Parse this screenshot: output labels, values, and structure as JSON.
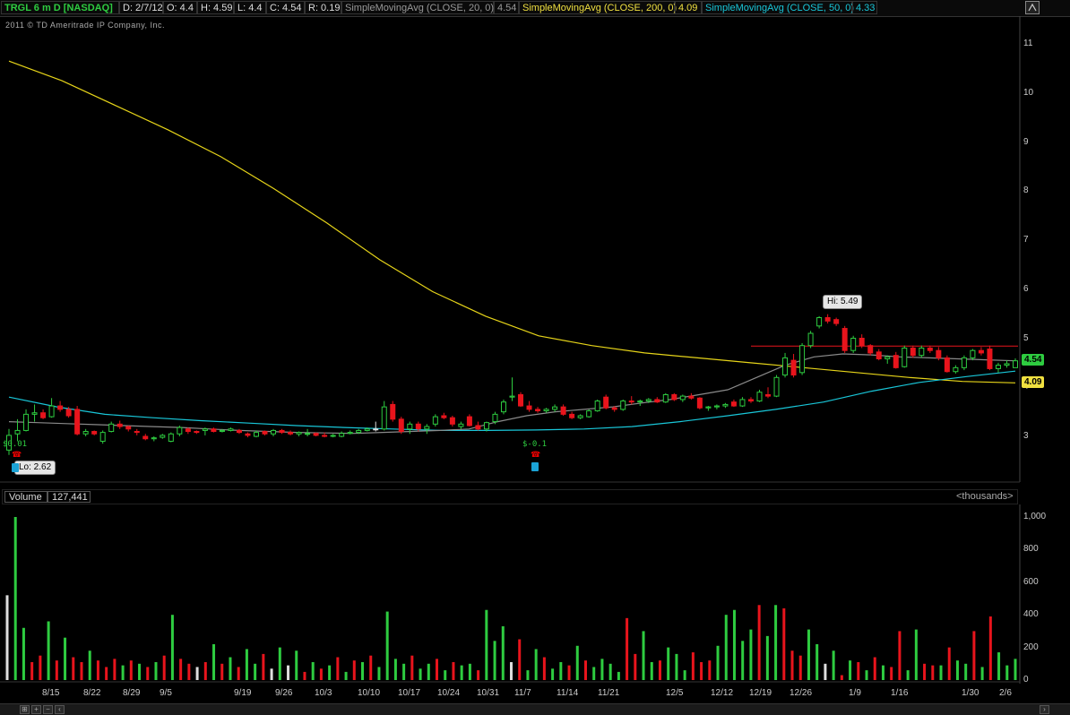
{
  "header": {
    "symbol": "TRGL 6 m D [NASDAQ]",
    "date": "D: 2/7/12",
    "open": "O: 4.4",
    "high": "H: 4.59",
    "low": "L: 4.4",
    "close": "C: 4.54",
    "range": "R: 0.19",
    "sma20_label": "SimpleMovingAvg (CLOSE, 20, 0)",
    "sma20_value": "4.54",
    "sma200_label": "SimpleMovingAvg (CLOSE, 200, 0)",
    "sma200_value": "4.09",
    "sma50_label": "SimpleMovingAvg (CLOSE, 50, 0)",
    "sma50_value": "4.33"
  },
  "copyright": "2011 © TD Ameritrade IP Company, Inc.",
  "annotations": {
    "hi": "Hi: 5.49",
    "lo": "Lo: 2.62",
    "dividend1": "$0.01",
    "dividend2": "$-0.1",
    "price_tag_green": "4.54",
    "price_tag_yellow": "4.09"
  },
  "volume_panel": {
    "label": "Volume",
    "value": "127,441",
    "units": "<thousands>"
  },
  "colors": {
    "up": "#2ecc40",
    "down": "#e8141c",
    "neutral": "#dddddd",
    "sma20": "#8a8a8a",
    "sma200": "#e6d419",
    "sma50": "#19c6d8",
    "resistance": "#e8141c"
  },
  "chart_data": [
    {
      "type": "candlestick",
      "title": "TRGL 6 m D [NASDAQ]",
      "ylim": [
        2.5,
        11.3
      ],
      "y_ticks": [
        3,
        4,
        5,
        6,
        7,
        8,
        9,
        10,
        11
      ],
      "x_ticks": [
        "8/15",
        "8/22",
        "8/29",
        "9/5",
        "9/19",
        "9/26",
        "10/3",
        "10/10",
        "10/17",
        "10/24",
        "10/31",
        "11/7",
        "11/14",
        "11/21",
        "12/5",
        "12/12",
        "12/19",
        "12/26",
        "1/9",
        "1/16",
        "1/30",
        "2/6"
      ],
      "candles": [
        {
          "o": 2.72,
          "h": 3.15,
          "l": 2.62,
          "c": 3.02
        },
        {
          "o": 3.05,
          "h": 3.35,
          "l": 2.9,
          "c": 3.12
        },
        {
          "o": 3.12,
          "h": 3.55,
          "l": 3.1,
          "c": 3.45
        },
        {
          "o": 3.45,
          "h": 3.65,
          "l": 3.3,
          "c": 3.48
        },
        {
          "o": 3.48,
          "h": 3.55,
          "l": 3.35,
          "c": 3.38
        },
        {
          "o": 3.4,
          "h": 3.78,
          "l": 3.38,
          "c": 3.62
        },
        {
          "o": 3.62,
          "h": 3.72,
          "l": 3.5,
          "c": 3.55
        },
        {
          "o": 3.55,
          "h": 3.6,
          "l": 3.38,
          "c": 3.42
        },
        {
          "o": 3.55,
          "h": 3.62,
          "l": 3.02,
          "c": 3.05
        },
        {
          "o": 3.05,
          "h": 3.15,
          "l": 3.0,
          "c": 3.1
        },
        {
          "o": 3.1,
          "h": 3.12,
          "l": 3.02,
          "c": 3.05
        },
        {
          "o": 2.9,
          "h": 3.12,
          "l": 2.85,
          "c": 3.08
        },
        {
          "o": 3.1,
          "h": 3.3,
          "l": 3.08,
          "c": 3.25
        },
        {
          "o": 3.25,
          "h": 3.32,
          "l": 3.15,
          "c": 3.2
        },
        {
          "o": 3.2,
          "h": 3.22,
          "l": 3.1,
          "c": 3.15
        },
        {
          "o": 3.1,
          "h": 3.15,
          "l": 3.02,
          "c": 3.08
        },
        {
          "o": 3.0,
          "h": 3.05,
          "l": 2.92,
          "c": 2.95
        },
        {
          "o": 2.95,
          "h": 3.0,
          "l": 2.9,
          "c": 2.97
        },
        {
          "o": 2.98,
          "h": 3.05,
          "l": 2.95,
          "c": 3.02
        },
        {
          "o": 2.9,
          "h": 3.08,
          "l": 2.88,
          "c": 3.05
        },
        {
          "o": 3.05,
          "h": 3.22,
          "l": 3.0,
          "c": 3.18
        },
        {
          "o": 3.15,
          "h": 3.18,
          "l": 3.05,
          "c": 3.1
        },
        {
          "o": 3.1,
          "h": 3.12,
          "l": 3.05,
          "c": 3.08
        },
        {
          "o": 3.12,
          "h": 3.18,
          "l": 3.02,
          "c": 3.15
        },
        {
          "o": 3.15,
          "h": 3.18,
          "l": 3.08,
          "c": 3.1
        },
        {
          "o": 3.1,
          "h": 3.15,
          "l": 3.08,
          "c": 3.12
        },
        {
          "o": 3.12,
          "h": 3.18,
          "l": 3.1,
          "c": 3.15
        },
        {
          "o": 3.12,
          "h": 3.15,
          "l": 3.05,
          "c": 3.08
        },
        {
          "o": 3.05,
          "h": 3.08,
          "l": 2.98,
          "c": 3.02
        },
        {
          "o": 3.0,
          "h": 3.12,
          "l": 2.98,
          "c": 3.08
        },
        {
          "o": 3.1,
          "h": 3.12,
          "l": 3.02,
          "c": 3.05
        },
        {
          "o": 3.05,
          "h": 3.15,
          "l": 3.0,
          "c": 3.12
        },
        {
          "o": 3.12,
          "h": 3.15,
          "l": 3.05,
          "c": 3.08
        },
        {
          "o": 3.08,
          "h": 3.12,
          "l": 3.02,
          "c": 3.05
        },
        {
          "o": 3.05,
          "h": 3.1,
          "l": 3.0,
          "c": 3.08
        },
        {
          "o": 3.05,
          "h": 3.15,
          "l": 3.0,
          "c": 3.06
        },
        {
          "o": 3.06,
          "h": 3.08,
          "l": 3.0,
          "c": 3.02
        },
        {
          "o": 3.02,
          "h": 3.08,
          "l": 2.98,
          "c": 3.0
        },
        {
          "o": 3.0,
          "h": 3.05,
          "l": 2.98,
          "c": 3.02
        },
        {
          "o": 3.0,
          "h": 3.1,
          "l": 2.98,
          "c": 3.06
        },
        {
          "o": 3.06,
          "h": 3.12,
          "l": 3.04,
          "c": 3.08
        },
        {
          "o": 3.08,
          "h": 3.15,
          "l": 3.05,
          "c": 3.12
        },
        {
          "o": 3.12,
          "h": 3.18,
          "l": 3.1,
          "c": 3.15
        },
        {
          "o": 3.15,
          "h": 3.3,
          "l": 3.1,
          "c": 3.15
        },
        {
          "o": 3.15,
          "h": 3.72,
          "l": 3.12,
          "c": 3.6
        },
        {
          "o": 3.65,
          "h": 3.72,
          "l": 3.3,
          "c": 3.35
        },
        {
          "o": 3.35,
          "h": 3.4,
          "l": 3.05,
          "c": 3.1
        },
        {
          "o": 3.15,
          "h": 3.3,
          "l": 3.05,
          "c": 3.25
        },
        {
          "o": 3.25,
          "h": 3.3,
          "l": 3.1,
          "c": 3.15
        },
        {
          "o": 3.15,
          "h": 3.25,
          "l": 3.05,
          "c": 3.2
        },
        {
          "o": 3.25,
          "h": 3.45,
          "l": 3.2,
          "c": 3.4
        },
        {
          "o": 3.42,
          "h": 3.48,
          "l": 3.35,
          "c": 3.38
        },
        {
          "o": 3.38,
          "h": 3.42,
          "l": 3.2,
          "c": 3.25
        },
        {
          "o": 3.2,
          "h": 3.3,
          "l": 3.15,
          "c": 3.25
        },
        {
          "o": 3.4,
          "h": 3.45,
          "l": 3.2,
          "c": 3.22
        },
        {
          "o": 3.22,
          "h": 3.3,
          "l": 3.12,
          "c": 3.15
        },
        {
          "o": 3.15,
          "h": 3.3,
          "l": 3.1,
          "c": 3.28
        },
        {
          "o": 3.3,
          "h": 3.5,
          "l": 3.25,
          "c": 3.45
        },
        {
          "o": 3.5,
          "h": 3.75,
          "l": 3.45,
          "c": 3.7
        },
        {
          "o": 3.8,
          "h": 4.2,
          "l": 3.72,
          "c": 3.82
        },
        {
          "o": 3.85,
          "h": 3.9,
          "l": 3.6,
          "c": 3.62
        },
        {
          "o": 3.62,
          "h": 3.72,
          "l": 3.5,
          "c": 3.55
        },
        {
          "o": 3.55,
          "h": 3.6,
          "l": 3.48,
          "c": 3.52
        },
        {
          "o": 3.52,
          "h": 3.58,
          "l": 3.48,
          "c": 3.55
        },
        {
          "o": 3.55,
          "h": 3.65,
          "l": 3.5,
          "c": 3.6
        },
        {
          "o": 3.6,
          "h": 3.65,
          "l": 3.42,
          "c": 3.45
        },
        {
          "o": 3.45,
          "h": 3.5,
          "l": 3.35,
          "c": 3.38
        },
        {
          "o": 3.38,
          "h": 3.45,
          "l": 3.35,
          "c": 3.42
        },
        {
          "o": 3.4,
          "h": 3.55,
          "l": 3.38,
          "c": 3.52
        },
        {
          "o": 3.52,
          "h": 3.75,
          "l": 3.5,
          "c": 3.72
        },
        {
          "o": 3.8,
          "h": 3.85,
          "l": 3.55,
          "c": 3.58
        },
        {
          "o": 3.58,
          "h": 3.62,
          "l": 3.5,
          "c": 3.55
        },
        {
          "o": 3.55,
          "h": 3.75,
          "l": 3.52,
          "c": 3.72
        },
        {
          "o": 3.72,
          "h": 3.82,
          "l": 3.65,
          "c": 3.7
        },
        {
          "o": 3.7,
          "h": 3.75,
          "l": 3.62,
          "c": 3.72
        },
        {
          "o": 3.72,
          "h": 3.78,
          "l": 3.68,
          "c": 3.75
        },
        {
          "o": 3.75,
          "h": 3.8,
          "l": 3.68,
          "c": 3.7
        },
        {
          "o": 3.7,
          "h": 3.88,
          "l": 3.68,
          "c": 3.85
        },
        {
          "o": 3.85,
          "h": 3.88,
          "l": 3.72,
          "c": 3.75
        },
        {
          "o": 3.75,
          "h": 3.85,
          "l": 3.7,
          "c": 3.82
        },
        {
          "o": 3.82,
          "h": 3.88,
          "l": 3.75,
          "c": 3.78
        },
        {
          "o": 3.78,
          "h": 3.8,
          "l": 3.55,
          "c": 3.58
        },
        {
          "o": 3.58,
          "h": 3.62,
          "l": 3.52,
          "c": 3.6
        },
        {
          "o": 3.6,
          "h": 3.65,
          "l": 3.55,
          "c": 3.62
        },
        {
          "o": 3.62,
          "h": 3.68,
          "l": 3.58,
          "c": 3.65
        },
        {
          "o": 3.7,
          "h": 3.75,
          "l": 3.6,
          "c": 3.62
        },
        {
          "o": 3.62,
          "h": 3.8,
          "l": 3.6,
          "c": 3.75
        },
        {
          "o": 3.75,
          "h": 3.8,
          "l": 3.68,
          "c": 3.72
        },
        {
          "o": 3.72,
          "h": 3.95,
          "l": 3.7,
          "c": 3.9
        },
        {
          "o": 3.85,
          "h": 4.0,
          "l": 3.78,
          "c": 3.82
        },
        {
          "o": 3.82,
          "h": 4.25,
          "l": 3.8,
          "c": 4.2
        },
        {
          "o": 4.25,
          "h": 4.7,
          "l": 4.2,
          "c": 4.6
        },
        {
          "o": 4.55,
          "h": 4.68,
          "l": 4.2,
          "c": 4.25
        },
        {
          "o": 4.3,
          "h": 4.9,
          "l": 4.25,
          "c": 4.85
        },
        {
          "o": 4.85,
          "h": 5.15,
          "l": 4.8,
          "c": 5.1
        },
        {
          "o": 5.25,
          "h": 5.45,
          "l": 5.2,
          "c": 5.42
        },
        {
          "o": 5.42,
          "h": 5.49,
          "l": 5.3,
          "c": 5.35
        },
        {
          "o": 5.38,
          "h": 5.42,
          "l": 5.25,
          "c": 5.3
        },
        {
          "o": 5.2,
          "h": 5.25,
          "l": 4.7,
          "c": 4.75
        },
        {
          "o": 4.75,
          "h": 5.05,
          "l": 4.7,
          "c": 5.0
        },
        {
          "o": 5.0,
          "h": 5.08,
          "l": 4.8,
          "c": 4.85
        },
        {
          "o": 4.85,
          "h": 4.88,
          "l": 4.65,
          "c": 4.7
        },
        {
          "o": 4.72,
          "h": 4.78,
          "l": 4.55,
          "c": 4.58
        },
        {
          "o": 4.58,
          "h": 4.65,
          "l": 4.48,
          "c": 4.62
        },
        {
          "o": 4.65,
          "h": 4.72,
          "l": 4.38,
          "c": 4.4
        },
        {
          "o": 4.42,
          "h": 4.85,
          "l": 4.4,
          "c": 4.8
        },
        {
          "o": 4.8,
          "h": 4.85,
          "l": 4.6,
          "c": 4.65
        },
        {
          "o": 4.65,
          "h": 4.85,
          "l": 4.6,
          "c": 4.8
        },
        {
          "o": 4.8,
          "h": 4.85,
          "l": 4.7,
          "c": 4.75
        },
        {
          "o": 4.75,
          "h": 4.82,
          "l": 4.55,
          "c": 4.6
        },
        {
          "o": 4.6,
          "h": 4.65,
          "l": 4.3,
          "c": 4.32
        },
        {
          "o": 4.32,
          "h": 4.45,
          "l": 4.28,
          "c": 4.4
        },
        {
          "o": 4.4,
          "h": 4.65,
          "l": 4.35,
          "c": 4.6
        },
        {
          "o": 4.6,
          "h": 4.78,
          "l": 4.55,
          "c": 4.75
        },
        {
          "o": 4.75,
          "h": 4.82,
          "l": 4.65,
          "c": 4.7
        },
        {
          "o": 4.78,
          "h": 4.85,
          "l": 4.35,
          "c": 4.38
        },
        {
          "o": 4.38,
          "h": 4.5,
          "l": 4.3,
          "c": 4.45
        },
        {
          "o": 4.45,
          "h": 4.55,
          "l": 4.4,
          "c": 4.48
        },
        {
          "o": 4.4,
          "h": 4.59,
          "l": 4.4,
          "c": 4.54
        }
      ],
      "sma20": [
        3.3,
        3.28,
        3.26,
        3.24,
        3.22,
        3.2,
        3.18,
        3.15,
        3.12,
        3.1,
        3.08,
        3.07,
        3.06,
        3.08,
        3.1,
        3.12,
        3.15,
        3.3,
        3.42,
        3.5,
        3.55,
        3.6,
        3.68,
        3.75,
        3.85,
        3.95,
        4.2,
        4.45,
        4.62,
        4.68,
        4.66,
        4.62,
        4.6,
        4.58,
        4.56,
        4.54
      ],
      "sma200": [
        10.65,
        10.25,
        9.75,
        9.25,
        8.7,
        8.05,
        7.35,
        6.6,
        5.95,
        5.45,
        5.05,
        4.85,
        4.7,
        4.6,
        4.5,
        4.4,
        4.3,
        4.2,
        4.12,
        4.09
      ],
      "sma50": [
        3.8,
        3.6,
        3.45,
        3.38,
        3.32,
        3.27,
        3.22,
        3.18,
        3.15,
        3.12,
        3.12,
        3.13,
        3.15,
        3.2,
        3.3,
        3.42,
        3.55,
        3.7,
        3.92,
        4.1,
        4.22,
        4.33
      ],
      "resistance_level": 4.84
    },
    {
      "type": "bar",
      "title": "Volume",
      "ylabel": "<thousands>",
      "ylim": [
        0,
        1100
      ],
      "y_ticks": [
        200,
        400,
        600,
        800,
        1000
      ],
      "y_tick_labels": [
        "200",
        "400",
        "600",
        "800",
        "1,000"
      ],
      "values": [
        520,
        1000,
        320,
        110,
        150,
        360,
        120,
        260,
        140,
        110,
        180,
        120,
        80,
        130,
        90,
        120,
        100,
        80,
        110,
        150,
        400,
        130,
        100,
        80,
        110,
        220,
        100,
        140,
        80,
        190,
        100,
        160,
        70,
        200,
        90,
        180,
        50,
        110,
        70,
        90,
        140,
        50,
        120,
        110,
        150,
        80,
        420,
        130,
        100,
        150,
        70,
        100,
        130,
        60,
        110,
        90,
        100,
        60,
        430,
        240,
        330,
        110,
        250,
        60,
        190,
        140,
        70,
        110,
        90,
        210,
        120,
        80,
        130,
        100,
        50,
        380,
        160,
        300,
        110,
        120,
        200,
        160,
        60,
        170,
        110,
        120,
        210,
        400,
        430,
        240,
        310,
        460,
        270,
        460,
        440,
        180,
        150,
        310,
        220,
        100,
        180,
        30,
        120,
        110,
        60,
        140,
        90,
        80,
        300,
        60,
        310,
        100,
        90,
        90,
        200,
        120,
        100,
        300,
        80,
        390,
        170,
        90,
        130
      ],
      "colors": [
        "n",
        "u",
        "u",
        "d",
        "d",
        "u",
        "d",
        "u",
        "d",
        "d",
        "u",
        "d",
        "d",
        "d",
        "u",
        "d",
        "u",
        "d",
        "u",
        "d",
        "u",
        "d",
        "d",
        "n",
        "d",
        "u",
        "d",
        "u",
        "d",
        "u",
        "u",
        "d",
        "n",
        "u",
        "n",
        "u",
        "d",
        "u",
        "d",
        "u",
        "d",
        "u",
        "d",
        "u",
        "d",
        "u",
        "u",
        "u",
        "u",
        "d",
        "u",
        "u",
        "d",
        "u",
        "d",
        "u",
        "u",
        "d",
        "u",
        "u",
        "u",
        "n",
        "d",
        "u",
        "u",
        "d",
        "u",
        "u",
        "d",
        "u",
        "d",
        "u",
        "u",
        "u",
        "u",
        "d",
        "d",
        "u",
        "u",
        "d",
        "u",
        "u",
        "u",
        "d",
        "d",
        "d",
        "u",
        "u",
        "u",
        "u",
        "u",
        "d",
        "u",
        "u",
        "d",
        "d",
        "d",
        "u",
        "u",
        "n",
        "u",
        "d",
        "u",
        "d",
        "u",
        "d",
        "u",
        "d",
        "d",
        "u",
        "u",
        "d",
        "d",
        "u",
        "d",
        "u",
        "u",
        "d",
        "u",
        "d",
        "u",
        "u",
        "u"
      ]
    }
  ]
}
